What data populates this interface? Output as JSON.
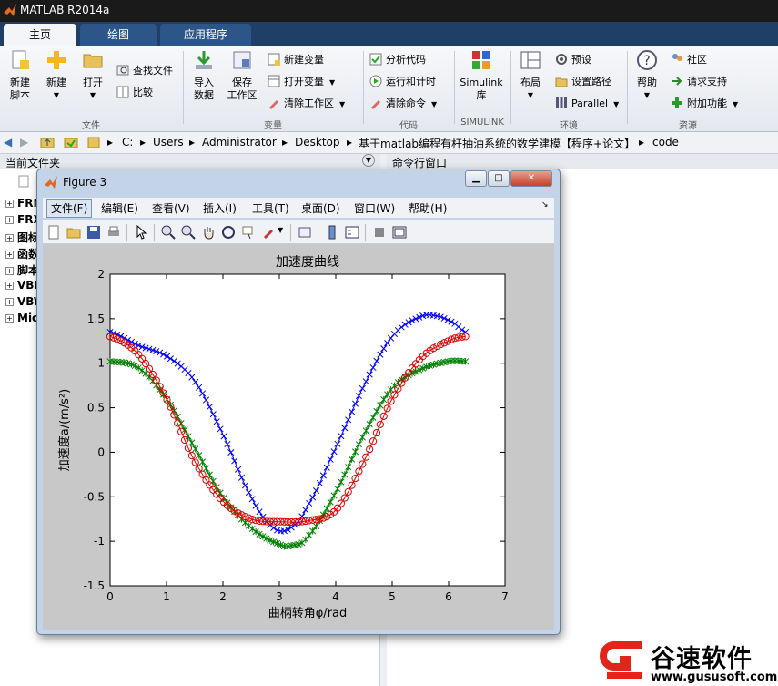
{
  "window": {
    "title": "MATLAB R2014a"
  },
  "tabs": [
    "主页",
    "绘图",
    "应用程序"
  ],
  "ribbon": {
    "new_script": [
      "新建",
      "脚本"
    ],
    "new": "新建",
    "open": "打开",
    "find_files": "查找文件",
    "compare": "比较",
    "group_file": "文件",
    "import": [
      "导入",
      "数据"
    ],
    "save": [
      "保存",
      "工作区"
    ],
    "new_var": "新建变量",
    "open_var": "打开变量",
    "clear_ws": "清除工作区",
    "group_var": "变量",
    "analyze": "分析代码",
    "run_time": "运行和计时",
    "clear_cmd": "清除命令",
    "group_code": "代码",
    "simulink": [
      "Simulink",
      "库"
    ],
    "group_simulink": "SIMULINK",
    "layout": "布局",
    "prefs": "预设",
    "set_path": "设置路径",
    "parallel": "Parallel",
    "group_env": "环境",
    "help": "帮助",
    "community": "社区",
    "support": "请求支持",
    "addons": "附加功能",
    "group_res": "资源"
  },
  "address": [
    "C:",
    "Users",
    "Administrator",
    "Desktop",
    "基于matlab编程有杆抽油系统的数学建模【程序+论文】",
    "code"
  ],
  "panes": {
    "current_folder": "当前文件夹",
    "command_window": "命令行窗口"
  },
  "tree": [
    "FRM",
    "FRX",
    "图标",
    "函数",
    "脚本",
    "VBR",
    "VBW",
    "Mic"
  ],
  "figure": {
    "title": "Figure 3",
    "menu": [
      "文件(F)",
      "编辑(E)",
      "查看(V)",
      "插入(I)",
      "工具(T)",
      "桌面(D)",
      "窗口(W)",
      "帮助(H)"
    ]
  },
  "chart_data": {
    "type": "line",
    "title": "加速度曲线",
    "xlabel": "曲柄转角φ/rad",
    "ylabel": "加速度a/(m/s²)",
    "xlim": [
      0,
      7
    ],
    "ylim": [
      -1.5,
      2
    ],
    "xticks": [
      "0",
      "1",
      "2",
      "3",
      "4",
      "5",
      "6",
      "7"
    ],
    "yticks": [
      "-1.5",
      "-1",
      "-0.5",
      "0",
      "0.5",
      "1",
      "1.5",
      "2"
    ],
    "grid": false,
    "series": [
      {
        "marker": "x",
        "color": "#0000ff",
        "x": [
          0,
          0.5,
          1.0,
          1.5,
          2.0,
          2.5,
          2.9,
          3.2,
          3.5,
          4.0,
          4.5,
          5.0,
          5.5,
          5.8,
          6.1,
          6.3
        ],
        "y": [
          1.35,
          1.2,
          1.08,
          0.8,
          0.2,
          -0.5,
          -0.85,
          -0.85,
          -0.6,
          0.05,
          0.75,
          1.3,
          1.52,
          1.53,
          1.45,
          1.35
        ]
      },
      {
        "marker": "*",
        "color": "#008000",
        "x": [
          0,
          0.5,
          1.0,
          1.5,
          2.0,
          2.5,
          3.0,
          3.2,
          3.5,
          4.0,
          4.5,
          5.0,
          5.5,
          6.0,
          6.3
        ],
        "y": [
          1.02,
          0.95,
          0.6,
          0.05,
          -0.5,
          -0.85,
          -1.03,
          -1.05,
          -0.95,
          -0.45,
          0.2,
          0.72,
          0.93,
          1.02,
          1.02
        ]
      },
      {
        "marker": "o",
        "color": "#e00000",
        "x": [
          0,
          0.5,
          1.0,
          1.5,
          2.0,
          2.5,
          3.0,
          3.5,
          4.0,
          4.5,
          5.0,
          5.5,
          6.0,
          6.3
        ],
        "y": [
          1.3,
          1.1,
          0.6,
          -0.1,
          -0.55,
          -0.75,
          -0.78,
          -0.77,
          -0.65,
          -0.1,
          0.6,
          1.05,
          1.25,
          1.3
        ]
      }
    ]
  },
  "watermark": {
    "brand": "谷速软件",
    "url": "www.gususoft.com"
  }
}
